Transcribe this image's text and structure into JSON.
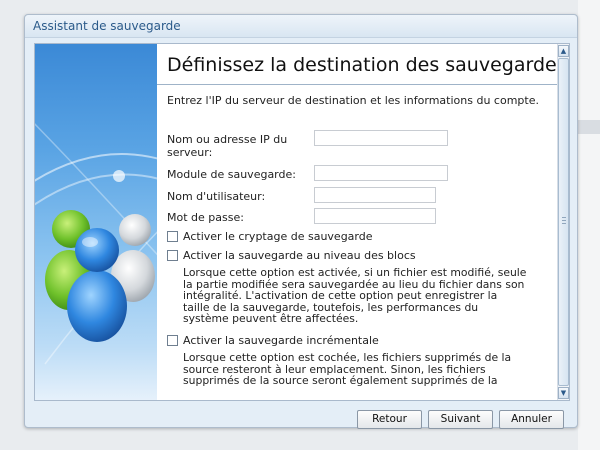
{
  "window": {
    "title": "Assistant de sauvegarde"
  },
  "page": {
    "heading": "Définissez la destination des sauvegardes",
    "intro": "Entrez l'IP du serveur de destination et les informations du compte."
  },
  "form": {
    "server_label": "Nom ou adresse IP du serveur:",
    "server_value": "",
    "module_label": "Module de sauvegarde:",
    "module_value": "",
    "username_label": "Nom d'utilisateur:",
    "username_value": "",
    "password_label": "Mot de passe:",
    "password_value": ""
  },
  "options": [
    {
      "label": "Activer le cryptage de sauvegarde",
      "checked": false,
      "description": ""
    },
    {
      "label": "Activer la sauvegarde au niveau des blocs",
      "checked": false,
      "description": "Lorsque cette option est activée, si un fichier est modifié, seule la partie modifiée sera sauvegardée au lieu du fichier dans son intégralité. L'activation de cette option peut enregistrer la taille de la sauvegarde, toutefois, les performances du système peuvent être affectées."
    },
    {
      "label": "Activer la sauvegarde incrémentale",
      "checked": false,
      "description": "Lorsque cette option est cochée, les fichiers supprimés de la source resteront à leur emplacement. Sinon, les fichiers supprimés de la source seront également supprimés de la"
    }
  ],
  "buttons": {
    "back": "Retour",
    "next": "Suivant",
    "cancel": "Annuler"
  },
  "icons": {
    "scroll_up": "chevron-up-icon",
    "scroll_down": "chevron-down-icon",
    "banner": "users-icon"
  },
  "colors": {
    "title_text": "#2b5a8a",
    "accent": "#3b89d6",
    "window_bg": "#e4eef7"
  }
}
